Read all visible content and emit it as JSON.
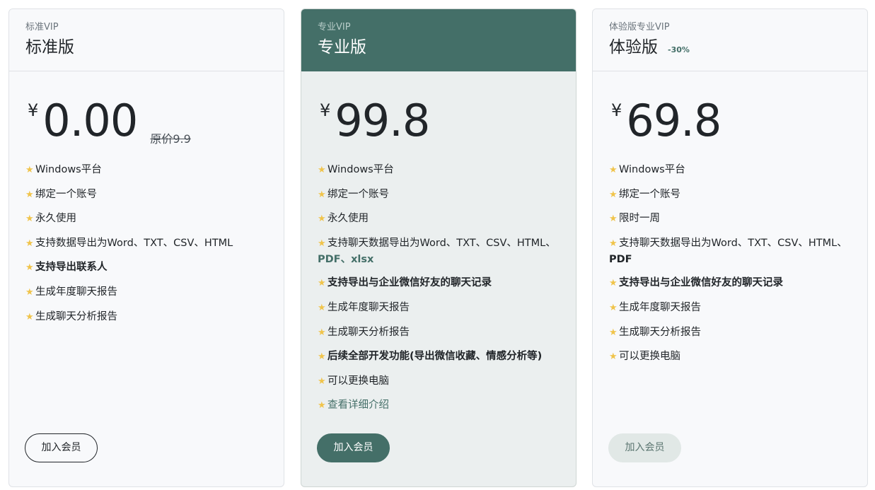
{
  "colors": {
    "accent": "#446f68",
    "star": "#f0c44b",
    "card_bg": "#f8f9fb",
    "featured_bg": "#ebefef"
  },
  "star_icon": "star-icon",
  "plans": [
    {
      "subtitle": "标准VIP",
      "title": "标准版",
      "currency": "¥",
      "price": "0.00",
      "original_price": "原价9.9",
      "features": {
        "f1": "Windows平台",
        "f2": "绑定一个账号",
        "f3": "永久使用",
        "f4": "支持数据导出为Word、TXT、CSV、HTML",
        "f5": "支持导出联系人",
        "f6": "生成年度聊天报告",
        "f7": "生成聊天分析报告"
      },
      "button": "加入会员"
    },
    {
      "subtitle": "专业VIP",
      "title": "专业版",
      "currency": "¥",
      "price": "99.8",
      "features": {
        "f1": "Windows平台",
        "f2": "绑定一个账号",
        "f3": "永久使用",
        "f4_prefix": "支持聊天数据导出为Word、TXT、CSV、HTML、",
        "f4_pdf": "PDF",
        "f4_sep": "、",
        "f4_xlsx": "xlsx",
        "f5": "支持导出与企业微信好友的聊天记录",
        "f6": "生成年度聊天报告",
        "f7": "生成聊天分析报告",
        "f8": "后续全部开发功能(导出微信收藏、情感分析等)",
        "f9": "可以更换电脑",
        "f10": "查看详细介绍"
      },
      "button": "加入会员"
    },
    {
      "subtitle": "体验版专业VIP",
      "title": "体验版",
      "discount": "-30%",
      "currency": "¥",
      "price": "69.8",
      "features": {
        "f1": "Windows平台",
        "f2": "绑定一个账号",
        "f3": "限时一周",
        "f4_prefix": "支持聊天数据导出为Word、TXT、CSV、HTML、",
        "f4_pdf": "PDF",
        "f5": "支持导出与企业微信好友的聊天记录",
        "f6": "生成年度聊天报告",
        "f7": "生成聊天分析报告",
        "f8": "可以更换电脑"
      },
      "button": "加入会员"
    }
  ]
}
